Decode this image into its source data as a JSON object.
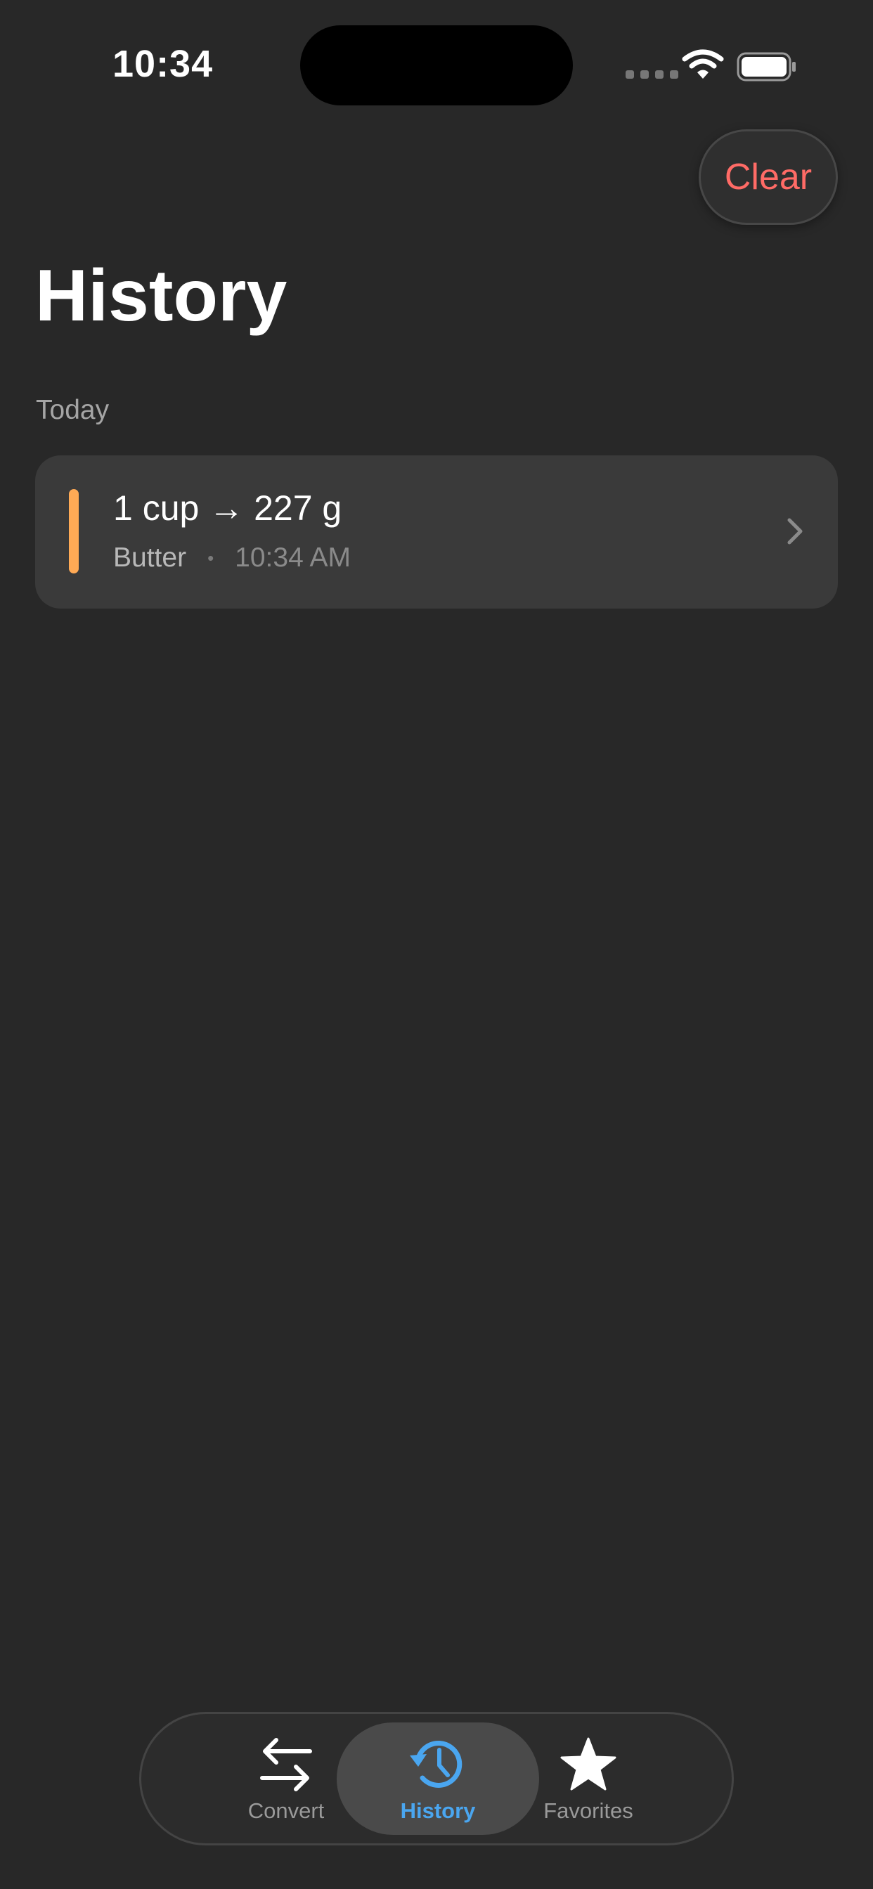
{
  "status_bar": {
    "time": "10:34"
  },
  "header": {
    "clear_label": "Clear",
    "title": "History"
  },
  "sections": [
    {
      "label": "Today",
      "items": [
        {
          "title": "1 cup → 227 g",
          "ingredient": "Butter",
          "separator": "•",
          "time": "10:34 AM",
          "accent_color": "#ffaa55"
        }
      ]
    }
  ],
  "tab_bar": {
    "tabs": [
      {
        "label": "Convert",
        "icon": "arrows-swap-icon",
        "active": false
      },
      {
        "label": "History",
        "icon": "clock-history-icon",
        "active": true
      },
      {
        "label": "Favorites",
        "icon": "star-icon",
        "active": false
      }
    ]
  },
  "colors": {
    "background": "#282828",
    "accent_blue": "#4aa6f0",
    "clear_red": "#ff6b66"
  }
}
